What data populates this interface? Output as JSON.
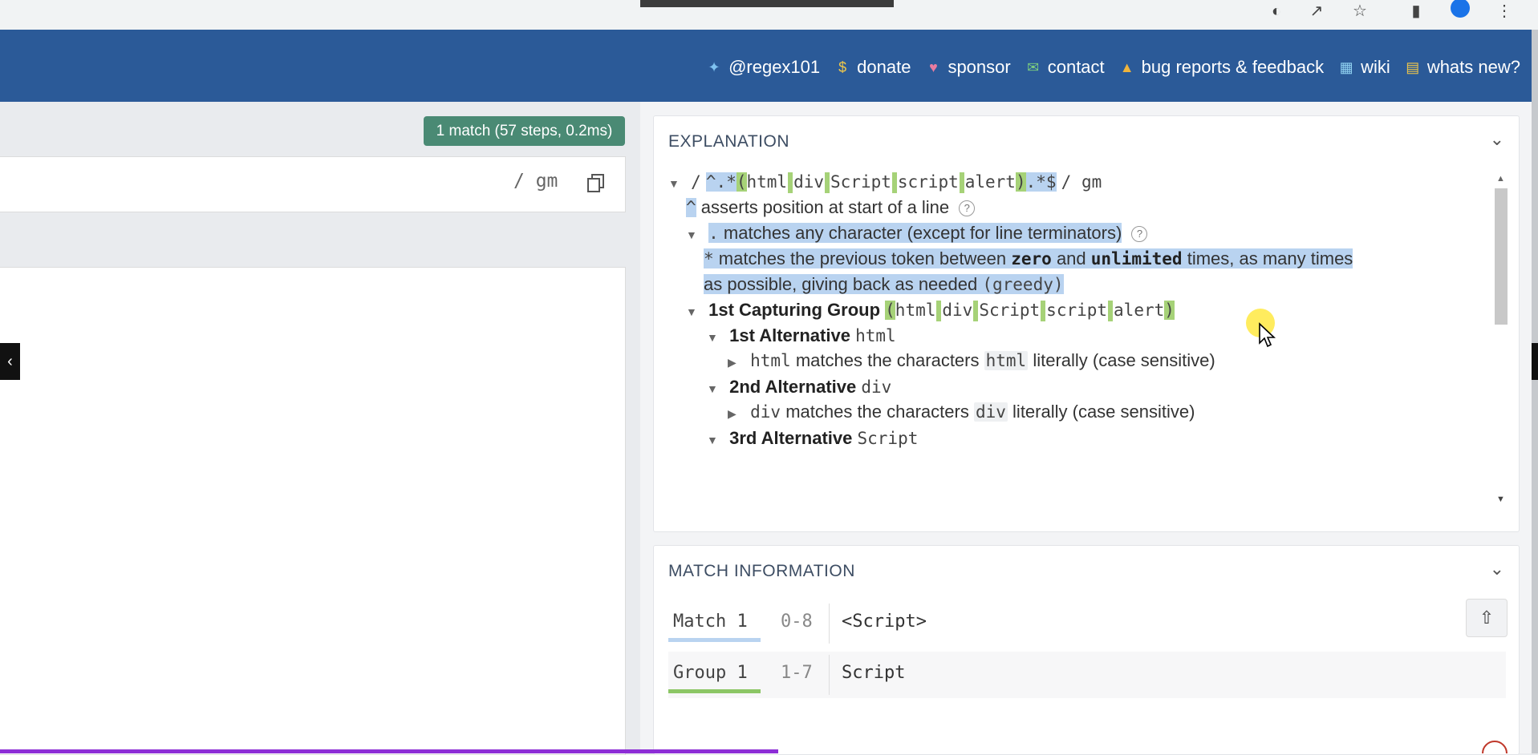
{
  "header": {
    "links": [
      {
        "icon": "twitter-icon",
        "label": "@regex101"
      },
      {
        "icon": "dollar-icon",
        "label": "donate"
      },
      {
        "icon": "heart-icon",
        "label": "sponsor"
      },
      {
        "icon": "mail-icon",
        "label": "contact"
      },
      {
        "icon": "warning-icon",
        "label": "bug reports & feedback"
      },
      {
        "icon": "wiki-icon",
        "label": "wiki"
      },
      {
        "icon": "news-icon",
        "label": "whats new?"
      }
    ]
  },
  "regex": {
    "match_badge": "1 match (57 steps, 0.2ms)",
    "flags": "/ gm"
  },
  "explanation": {
    "title": "EXPLANATION",
    "lines": {
      "l0_slash": "/",
      "l0_a": "^.*",
      "l0_b": "(",
      "l0_c": "html",
      "l0_d": "div",
      "l0_e": "Script",
      "l0_f": "script",
      "l0_g": "alert",
      "l0_h": ")",
      "l0_i": ".*$",
      "l0_flags": "/ gm",
      "l1_tok": "^",
      "l1_text": "asserts position at start of a line",
      "l2_tok": ".",
      "l2_text": "matches any character (except for line terminators)",
      "l3_tok": "*",
      "l3_t1": "matches the previous token between",
      "l3_zero": "zero",
      "l3_and": "and",
      "l3_unl": "unlimited",
      "l3_t2": "times, as many times",
      "l4_t1": "as possible, giving back as needed",
      "l4_greedy": "(greedy)",
      "l5_title": "1st Capturing Group",
      "l5_a": "(",
      "l5_b": "html",
      "l5_c": "div",
      "l5_d": "Script",
      "l5_e": "script",
      "l5_f": "alert",
      "l5_g": ")",
      "l6_title": "1st Alternative",
      "l6_code": "html",
      "l7_code": "html",
      "l7_text": "matches the characters",
      "l7_chip": "html",
      "l7_tail": "literally (case sensitive)",
      "l8_title": "2nd Alternative",
      "l8_code": "div",
      "l9_code": "div",
      "l9_text": "matches the characters",
      "l9_chip": "div",
      "l9_tail": "literally (case sensitive)",
      "l10_title": "3rd Alternative",
      "l10_code": "Script"
    }
  },
  "match_info": {
    "title": "MATCH INFORMATION",
    "rows": [
      {
        "label": "Match 1",
        "range": "0-8",
        "value": "<Script>",
        "color": "#b9d3f0"
      },
      {
        "label": "Group 1",
        "range": "1-7",
        "value": "Script",
        "color": "#8cc665"
      }
    ]
  }
}
